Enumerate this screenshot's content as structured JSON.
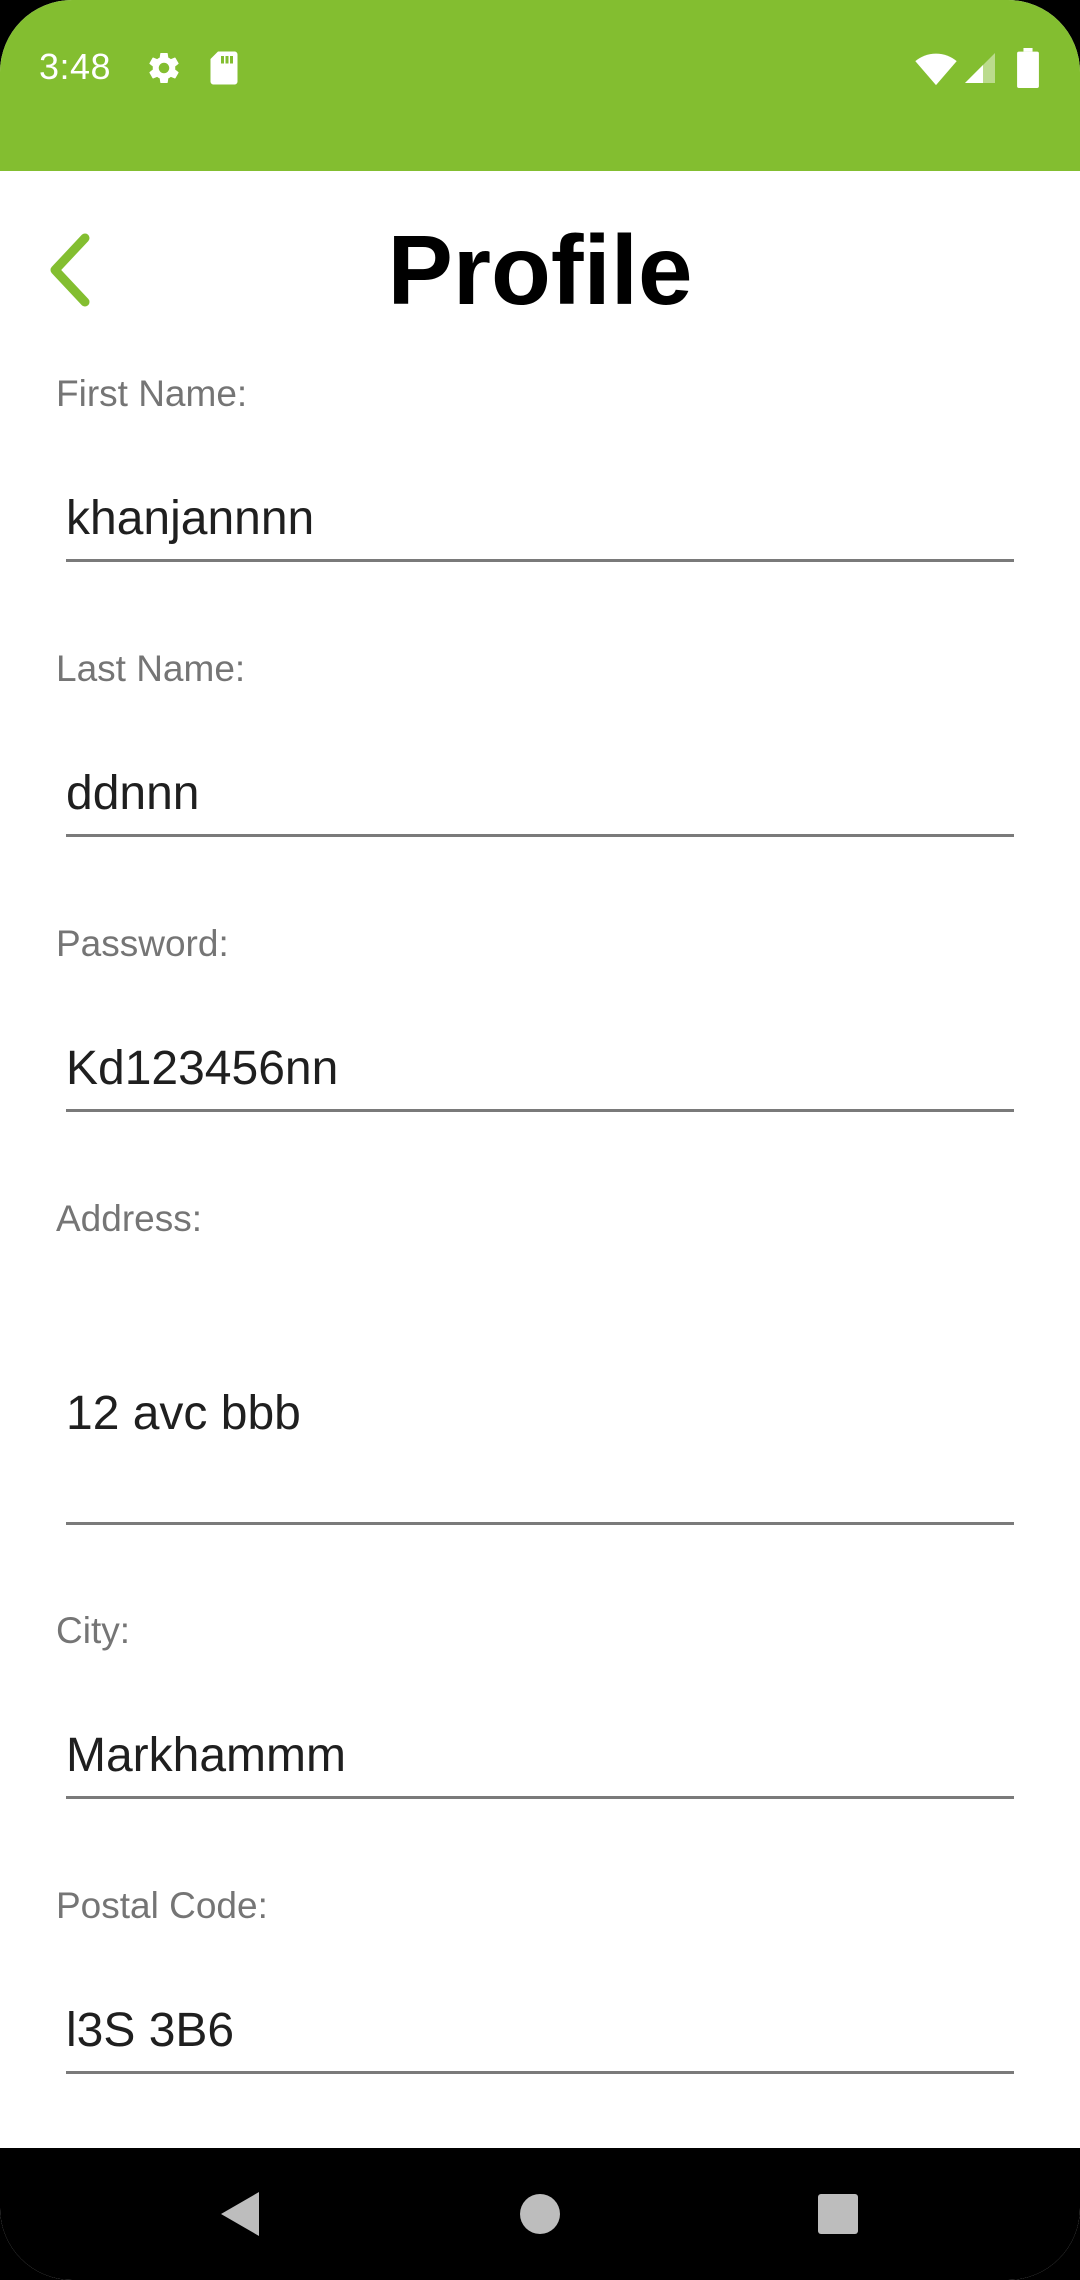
{
  "status_bar": {
    "time": "3:48",
    "background_color": "#83BE30",
    "icons": [
      "gear-icon",
      "sd-card-icon",
      "wifi-icon",
      "signal-icon",
      "battery-icon"
    ]
  },
  "header": {
    "title": "Profile",
    "back_icon": "chevron-left-icon",
    "accent_color": "#83BE30"
  },
  "form": {
    "first_name": {
      "label": "First Name:",
      "value": "khanjannnn"
    },
    "last_name": {
      "label": "Last Name:",
      "value": "ddnnn"
    },
    "password": {
      "label": "Password:",
      "value": "Kd123456nn"
    },
    "address": {
      "label": "Address:",
      "value": "12 avc bbb"
    },
    "city": {
      "label": "City:",
      "value": "Markhammm"
    },
    "postal_code": {
      "label": "Postal Code:",
      "value": "l3S 3B6"
    }
  },
  "nav_bar": {
    "icons": [
      "back-triangle-icon",
      "home-circle-icon",
      "recents-square-icon"
    ]
  }
}
